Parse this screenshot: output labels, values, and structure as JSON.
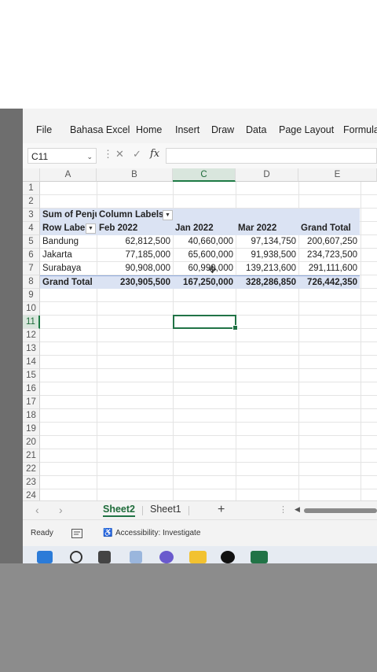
{
  "menu": [
    "File",
    "Bahasa Excel",
    "Home",
    "Insert",
    "Draw",
    "Data",
    "Page Layout",
    "Formula"
  ],
  "formula_bar": {
    "name_box": "C11",
    "fx": "fx",
    "cancel": "✕",
    "enter": "✓"
  },
  "columns": [
    "A",
    "B",
    "C",
    "D",
    "E"
  ],
  "rows": [
    "1",
    "2",
    "3",
    "4",
    "5",
    "6",
    "7",
    "8",
    "9",
    "10",
    "11",
    "12",
    "13",
    "14",
    "15",
    "16",
    "17",
    "18",
    "19",
    "20",
    "21",
    "22",
    "23",
    "24"
  ],
  "pivot": {
    "value_field": "Sum of Penju",
    "column_labels": "Column Labels",
    "row_labels": "Row Labe",
    "headers": [
      "Feb 2022",
      "Jan 2022",
      "Mar 2022",
      "Grand Total"
    ],
    "data": [
      {
        "label": "Bandung",
        "values": [
          "62,812,500",
          "40,660,000",
          "97,134,750",
          "200,607,250"
        ]
      },
      {
        "label": "Jakarta",
        "values": [
          "77,185,000",
          "65,600,000",
          "91,938,500",
          "234,723,500"
        ]
      },
      {
        "label": "Surabaya",
        "values": [
          "90,908,000",
          "60,990,000",
          "139,213,600",
          "291,111,600"
        ]
      }
    ],
    "total": {
      "label": "Grand Total",
      "values": [
        "230,905,500",
        "167,250,000",
        "328,286,850",
        "726,442,350"
      ]
    }
  },
  "sheets": {
    "active": "Sheet2",
    "other": "Sheet1",
    "add": "+"
  },
  "status": {
    "ready": "Ready",
    "accessibility": "Accessibility: Investigate"
  },
  "colors": {
    "excel_green": "#217346",
    "pivot_header": "#dbe3f3"
  }
}
